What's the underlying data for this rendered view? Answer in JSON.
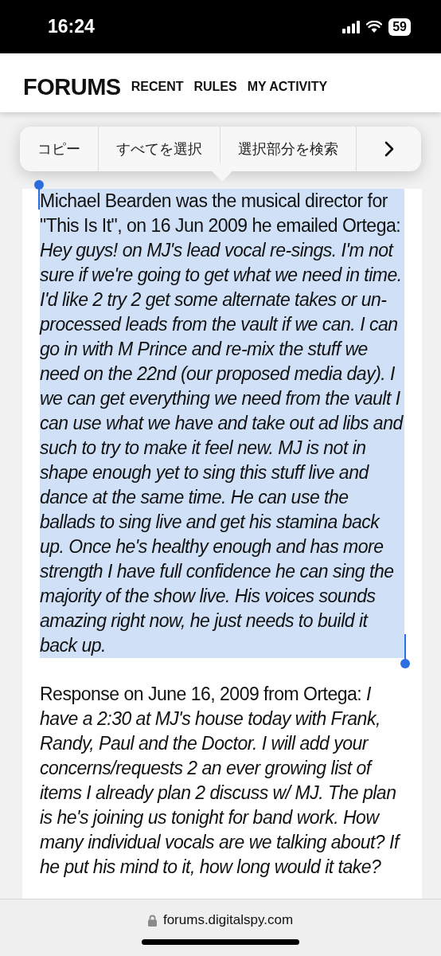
{
  "status_bar": {
    "time": "16:24",
    "battery": "59"
  },
  "header": {
    "logo": "FORUMS",
    "nav": [
      "RECENT",
      "RULES",
      "MY ACTIVITY"
    ]
  },
  "post": {
    "paragraphs": [
      {
        "text": "Michael Bearden was the musical director for \"This Is It\", on 16 Jun 2009 he emailed Ortega: *Hey guys! on MJ's lead vocal re-sings. I'm not sure if we're going to get what we need in time. I'd like 2 try 2 get some alternate takes or un-processed leads from the vault if we can. I can go in with M Prince and re-mix the stuff we need on the 22nd (our proposed media day). I we can get everything we need from the vault I can use what we have and take out ad libs and such to try to make it feel new. MJ is not in shape enough yet to sing this stuff live and dance at the same time. He can use the ballads to sing live and get his stamina back up. Once he's healthy enough and has more strength I have full confidence he can sing the majority of the show live. His voices sounds amazing right now, he just needs to build it back up.*",
        "selected": true
      },
      {
        "text": "Response on June 16, 2009 from Ortega: *I have a 2:30 at MJ's house today with Frank, Randy, Paul and the Doctor. I will add your concerns/requests 2 an ever growing list of items I already plan 2 discuss w/ MJ. The plan is he's joining us tonight for band work. How many individual vocals are we talking about? If he put his mind to it, how long would it take?*",
        "selected": false
      }
    ]
  },
  "context_menu": {
    "items": [
      "コピー",
      "すべてを選択",
      "選択部分を検索"
    ]
  },
  "address_bar": {
    "url": "forums.digitalspy.com"
  }
}
